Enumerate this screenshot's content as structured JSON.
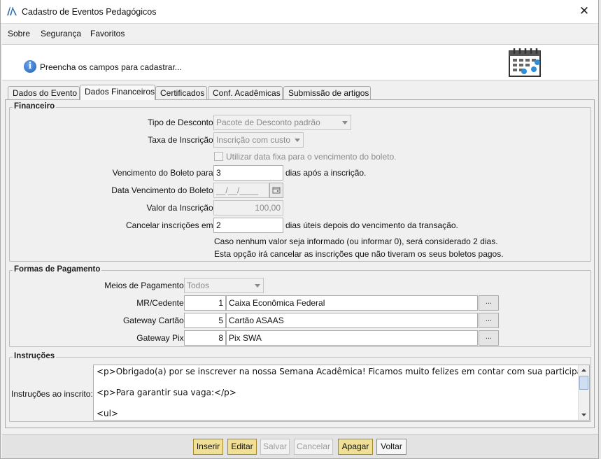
{
  "window": {
    "title": "Cadastro de Eventos Pedagógicos",
    "close_glyph": "✕"
  },
  "menu": [
    {
      "label": "Sobre"
    },
    {
      "label": "Segurança"
    },
    {
      "label": "Favoritos"
    }
  ],
  "info": {
    "text": "Preencha os campos para cadastrar...",
    "icon_glyph": "i"
  },
  "tabs": [
    {
      "label": "Dados do Evento"
    },
    {
      "label": "Dados Financeiros",
      "active": true
    },
    {
      "label": "Certificados"
    },
    {
      "label": "Conf. Acadêmicas"
    },
    {
      "label": "Submissão de artigos"
    }
  ],
  "financeiro": {
    "title": "Financeiro",
    "tipo_desconto_label": "Tipo de Desconto:",
    "tipo_desconto_value": "Pacote de Desconto padrão",
    "taxa_label": "Taxa de Inscrição:",
    "taxa_value": "Inscrição com custo",
    "data_fixa_label": "Utilizar data fixa para o vencimento do boleto.",
    "vencimento_label": "Vencimento do Boleto para:",
    "vencimento_value": "3",
    "vencimento_suffix": "dias após a inscrição.",
    "data_venc_label": "Data Vencimento do Boleto:",
    "data_venc_placeholder": "__/__/____",
    "valor_label": "Valor da Inscrição:",
    "valor_value": "100,00",
    "cancelar_label": "Cancelar inscrições em:",
    "cancelar_value": "2",
    "cancelar_suffix": "dias úteis depois do vencimento da transação.",
    "note1": "Caso nenhum valor seja informado (ou informar 0), será considerado 2 dias.",
    "note2": "Esta opção irá cancelar as inscrições que não tiveram os seus boletos pagos."
  },
  "pagamento": {
    "title": "Formas de Pagamento",
    "meios_label": "Meios de Pagamento:",
    "meios_value": "Todos",
    "rows": [
      {
        "label": "MR/Cedente:",
        "code": "1",
        "name": "Caixa Econômica Federal",
        "btn": "..."
      },
      {
        "label": "Gateway Cartão:",
        "code": "5",
        "name": "Cartão ASAAS",
        "btn": "..."
      },
      {
        "label": "Gateway Pix:",
        "code": "8",
        "name": "Pix SWA",
        "btn": "..."
      }
    ]
  },
  "instrucoes": {
    "title": "Instruções",
    "label": "Instruções ao inscrito:",
    "lines": [
      "<p>Obrigado(a) por se inscrever na nossa Semana Acadêmica! Ficamos muito felizes em contar com sua participação.</p>",
      "",
      "<p>Para garantir sua vaga:</p>",
      "",
      "<ul>"
    ]
  },
  "buttons": [
    {
      "label": "Inserir",
      "state": "enabled"
    },
    {
      "label": "Editar",
      "state": "enabled"
    },
    {
      "label": "Salvar",
      "state": "disabled"
    },
    {
      "label": "Cancelar",
      "state": "disabled"
    },
    {
      "label": "Apagar",
      "state": "enabled"
    },
    {
      "label": "Voltar",
      "state": "enabled"
    }
  ]
}
